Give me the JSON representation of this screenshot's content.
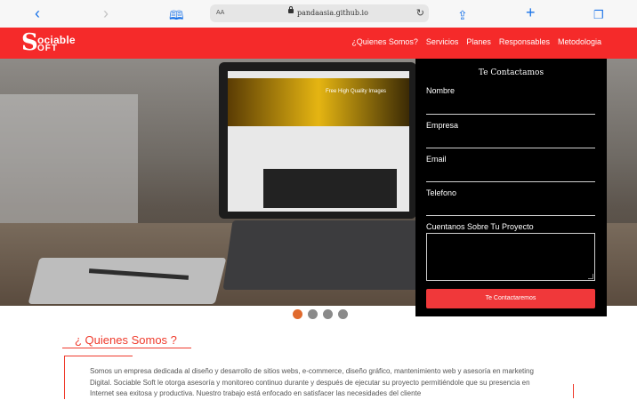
{
  "browser": {
    "text_size_label": "AA",
    "url_host": "pandaasia.github.io"
  },
  "header": {
    "logo_big": "S",
    "logo_line1": "ociable",
    "logo_line2": "OFT",
    "menu": [
      "¿Quienes Somos?",
      "Servicios",
      "Planes",
      "Responsables",
      "Metodologia"
    ],
    "brand_color": "#f52a2a"
  },
  "hero": {
    "screen_text": "Free High Quality Images"
  },
  "contact": {
    "title": "Te Contactamos",
    "fields": [
      "Nombre",
      "Empresa",
      "Email",
      "Telefono",
      "Cuentanos Sobre Tu Proyecto"
    ],
    "submit_label": "Te Contactaremos"
  },
  "carousel": {
    "count": 4,
    "active_index": 0,
    "active_color": "#e06a2d"
  },
  "about": {
    "title": "¿ Quienes Somos ?",
    "text": "Somos un empresa dedicada al diseño y desarrollo de sitios webs, e-commerce, diseño gráfico, mantenimiento web y asesoría en marketing Digital. Sociable Soft le otorga asesoría y monitoreo continuo durante y después de ejecutar su proyecto permitiéndole que su presencia en Internet sea exitosa y productiva. Nuestro trabajo está enfocado en satisfacer las necesidades del cliente"
  }
}
